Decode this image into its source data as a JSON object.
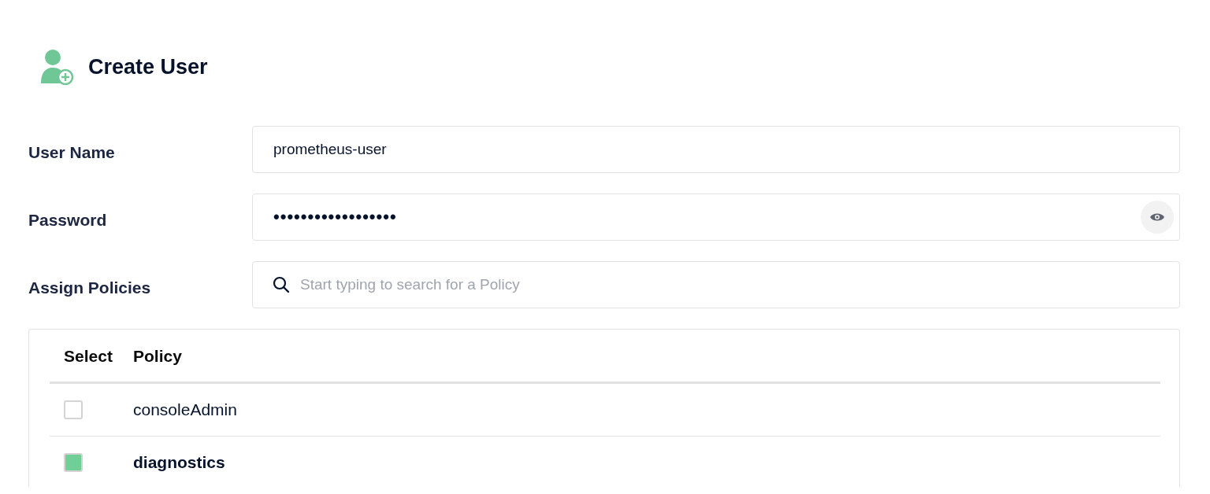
{
  "title": "Create User",
  "fields": [
    {
      "kind": "text",
      "label": "User Name",
      "value": "prometheus-user"
    },
    {
      "kind": "password",
      "label": "Password",
      "value": "••••••••••••••••••"
    },
    {
      "kind": "search",
      "label": "Assign Policies",
      "placeholder": "Start typing to search for a Policy"
    }
  ],
  "table": {
    "columns": [
      "Select",
      "Policy"
    ],
    "rows": [
      {
        "policy": "consoleAdmin",
        "checked": false
      },
      {
        "policy": "diagnostics",
        "checked": true
      }
    ]
  }
}
